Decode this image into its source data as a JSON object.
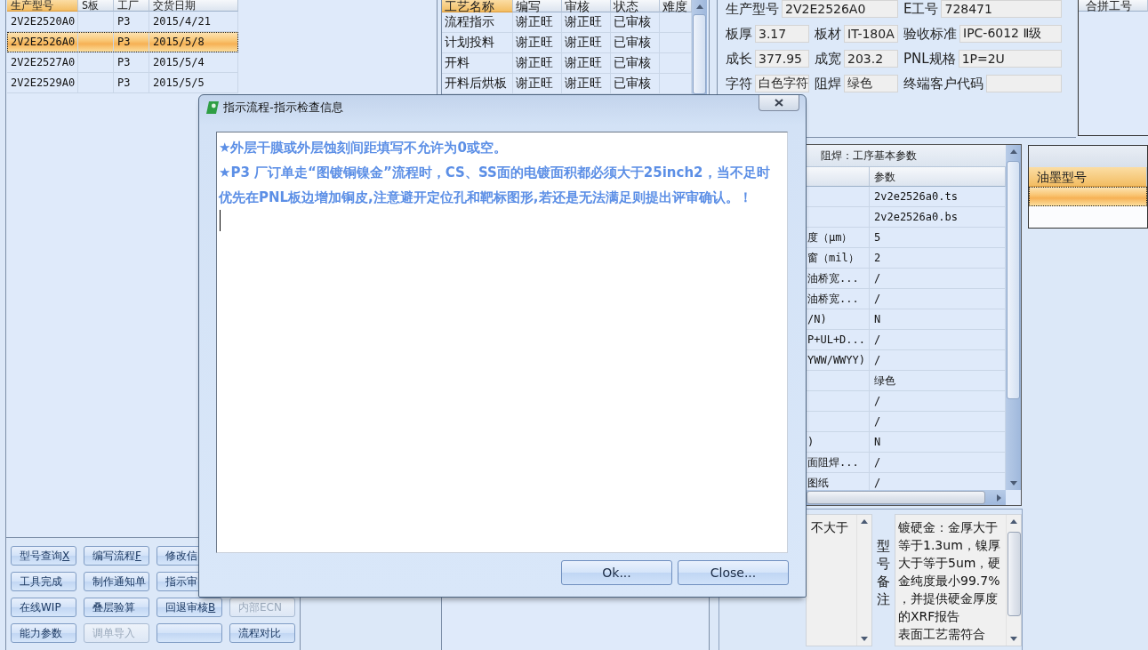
{
  "orders_table": {
    "columns": [
      {
        "label": "生产型号",
        "selected": true
      },
      {
        "label": "S板",
        "selected": false
      },
      {
        "label": "工厂",
        "selected": false
      },
      {
        "label": "交货日期",
        "selected": false
      }
    ],
    "rows": [
      {
        "model_no": "2V2E2520A0",
        "factory": "P3",
        "delivery_date": "2015/4/21",
        "selected": false
      },
      {
        "model_no": "2V2E2526A0",
        "factory": "P3",
        "delivery_date": "2015/5/8",
        "selected": true
      },
      {
        "model_no": "2V2E2527A0",
        "factory": "P3",
        "delivery_date": "2015/5/4",
        "selected": false
      },
      {
        "model_no": "2V2E2529A0",
        "factory": "P3",
        "delivery_date": "2015/5/5",
        "selected": false
      }
    ]
  },
  "process_table": {
    "columns": [
      {
        "label": "工艺名称",
        "selected": true
      },
      {
        "label": "编写",
        "selected": false
      },
      {
        "label": "审核",
        "selected": false
      },
      {
        "label": "状态",
        "selected": false
      },
      {
        "label": "难度",
        "selected": false
      }
    ],
    "rows": [
      {
        "process": "流程指示",
        "author": "谢正旺",
        "reviewer": "谢正旺",
        "status": "已审核",
        "selected": false
      },
      {
        "process": "计划投料",
        "author": "谢正旺",
        "reviewer": "谢正旺",
        "status": "已审核",
        "selected": false
      },
      {
        "process": "开料",
        "author": "谢正旺",
        "reviewer": "谢正旺",
        "status": "已审核",
        "selected": false
      },
      {
        "process": "开料后烘板",
        "author": "谢正旺",
        "reviewer": "谢正旺",
        "status": "已审核",
        "selected": false
      }
    ]
  },
  "order_fields": [
    [
      {
        "label": "生产型号",
        "value": "2V2E2526A0"
      },
      {
        "label": "E工号",
        "value": "728471"
      }
    ],
    [
      {
        "label": "板厚",
        "value": "3.17"
      },
      {
        "label": "板材",
        "value": "IT-180A"
      },
      {
        "label": "验收标准",
        "value": "IPC-6012 Ⅱ级"
      }
    ],
    [
      {
        "label": "成长",
        "value": "377.95"
      },
      {
        "label": "成宽",
        "value": "203.2"
      },
      {
        "label": "PNL规格",
        "value": "1P=2U"
      }
    ],
    [
      {
        "label": "字符",
        "value": "白色字符"
      },
      {
        "label": "阻焊",
        "value": "绿色"
      },
      {
        "label": "终端客户代码"
      }
    ]
  ],
  "merge_list": {
    "columns": [
      {
        "label": "合拼工号",
        "selected": false
      }
    ]
  },
  "parameters": {
    "title": "阻焊：工序基本参数",
    "value_header": "参数",
    "rows": [
      {
        "value": "2v2e2526a0.ts"
      },
      {
        "value": "2v2e2526a0.bs"
      },
      {
        "name": "度（μm）",
        "value": "5"
      },
      {
        "name": "窗（mil）",
        "value": "2"
      },
      {
        "name": "油桥宽...",
        "value": "/"
      },
      {
        "name": "油桥宽...",
        "value": "/"
      },
      {
        "name": "/N)",
        "value": "N"
      },
      {
        "name": "P+UL+D...",
        "value": "/"
      },
      {
        "name": "YWW/WWYY)",
        "value": "/"
      },
      {
        "value": "绿色"
      },
      {
        "value": "/"
      },
      {
        "value": "/"
      },
      {
        "name": ")",
        "value": "N"
      },
      {
        "name": "面阻焊...",
        "value": "/"
      },
      {
        "name": "图纸",
        "value": "/"
      }
    ]
  },
  "ink_list": {
    "columns": [
      {
        "label": "油墨型号",
        "selected": true
      }
    ],
    "rows": [
      {
        "selected": true
      }
    ]
  },
  "remarks": {
    "left_note": "不大于",
    "label": "型号备注",
    "model_note": [
      "镀硬金：金厚大于等于1.3um，镍厚大于等于5um，硬金纯度最小99.7%，并提供硬金厚度的XRF报告",
      "表面工艺需符合"
    ]
  },
  "action_buttons": [
    [
      {
        "label": "型号查询",
        "shortcut": "X",
        "disabled": false
      },
      {
        "label": "编写流程",
        "shortcut": "F",
        "disabled": false
      },
      {
        "label": "修改信",
        "disabled": false
      }
    ],
    [
      {
        "label": "工具完成",
        "disabled": false
      },
      {
        "label": "制作通知单",
        "disabled": false
      },
      {
        "label": "指示审",
        "disabled": false
      }
    ],
    [
      {
        "label": "在线WIP",
        "disabled": false
      },
      {
        "label": "叠层验算",
        "disabled": false
      },
      {
        "label": "回退审核",
        "shortcut": "B",
        "disabled": false
      },
      {
        "label": "内部ECN",
        "disabled": true
      }
    ],
    [
      {
        "label": "能力参数",
        "disabled": false
      },
      {
        "label": "调单导入",
        "disabled": true
      },
      {
        "disabled": false
      },
      {
        "label": "流程对比",
        "disabled": false
      }
    ]
  ],
  "dialog": {
    "title": "指示流程-指示检查信息",
    "messages": [
      "★外层干膜或外层蚀刻间距填写不允许为0或空。",
      "★P3 厂订单走“图镀铜镍金”流程时，CS、SS面的电镀面积都必须大于25inch2，当不足时优先在PNL板边增加铜皮,注意避开定位孔和靶标图形,若还是无法满足则提出评审确认。！"
    ],
    "buttons": [
      "Ok...",
      "Close..."
    ]
  }
}
